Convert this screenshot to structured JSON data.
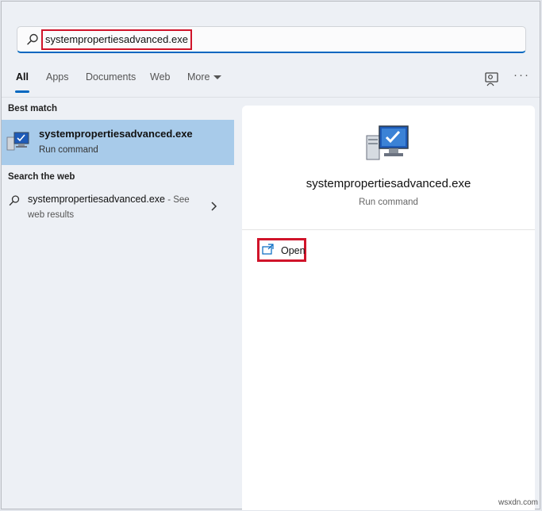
{
  "search": {
    "query": "systempropertiesadvanced.exe"
  },
  "tabs": [
    {
      "label": "All"
    },
    {
      "label": "Apps"
    },
    {
      "label": "Documents"
    },
    {
      "label": "Web"
    },
    {
      "label": "More"
    }
  ],
  "toolbar": {
    "more_options_label": "···"
  },
  "best_match": {
    "section_label": "Best match",
    "title": "systempropertiesadvanced.exe",
    "subtitle": "Run command"
  },
  "web": {
    "section_label": "Search the web",
    "title": "systempropertiesadvanced.exe",
    "see_label": " - See",
    "subtitle": "web results"
  },
  "details": {
    "title": "systempropertiesadvanced.exe",
    "subtitle": "Run command",
    "actions": [
      {
        "label": "Open",
        "icon": "open-external-icon"
      }
    ]
  },
  "watermark": "wsxdn.com",
  "colors": {
    "accent": "#0067c0",
    "highlight": "#a8cbea",
    "annotation": "#d0142a"
  }
}
